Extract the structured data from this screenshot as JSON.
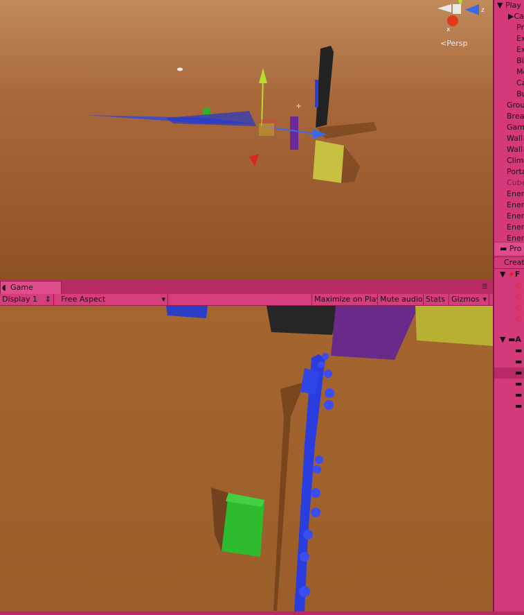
{
  "hierarchy": {
    "root_label": "Play",
    "items": [
      {
        "label": "Ca",
        "expander": true
      },
      {
        "label": "Pr"
      },
      {
        "label": "Ex"
      },
      {
        "label": "Ex"
      },
      {
        "label": "Bi"
      },
      {
        "label": "Mo"
      },
      {
        "label": "Ca"
      },
      {
        "label": "Bu"
      },
      {
        "label": "Grou"
      },
      {
        "label": "Break"
      },
      {
        "label": "Gam"
      },
      {
        "label": "Wall"
      },
      {
        "label": "Wall"
      },
      {
        "label": "Clim"
      },
      {
        "label": "Porta"
      },
      {
        "label": "Cube",
        "dim": true
      },
      {
        "label": "Ener"
      },
      {
        "label": "Ener"
      },
      {
        "label": "Ener"
      },
      {
        "label": "Ener"
      },
      {
        "label": "Ener"
      }
    ]
  },
  "scene": {
    "gizmo_label": "Persp",
    "axis_x": "x",
    "axis_z": "z"
  },
  "project": {
    "tab_label": "Pro",
    "create_label": "Creat",
    "favorites_label": "F",
    "assets_label": "A"
  },
  "game": {
    "tab_label": "Game",
    "display": "Display 1",
    "aspect": "Free Aspect",
    "maximize": "Maximize on Play",
    "mute": "Mute audio",
    "stats": "Stats",
    "gizmos": "Gizmos"
  },
  "colors": {
    "accent": "#d43a7a",
    "ground": "#a0602c",
    "sphere": "#2a3ee0"
  }
}
